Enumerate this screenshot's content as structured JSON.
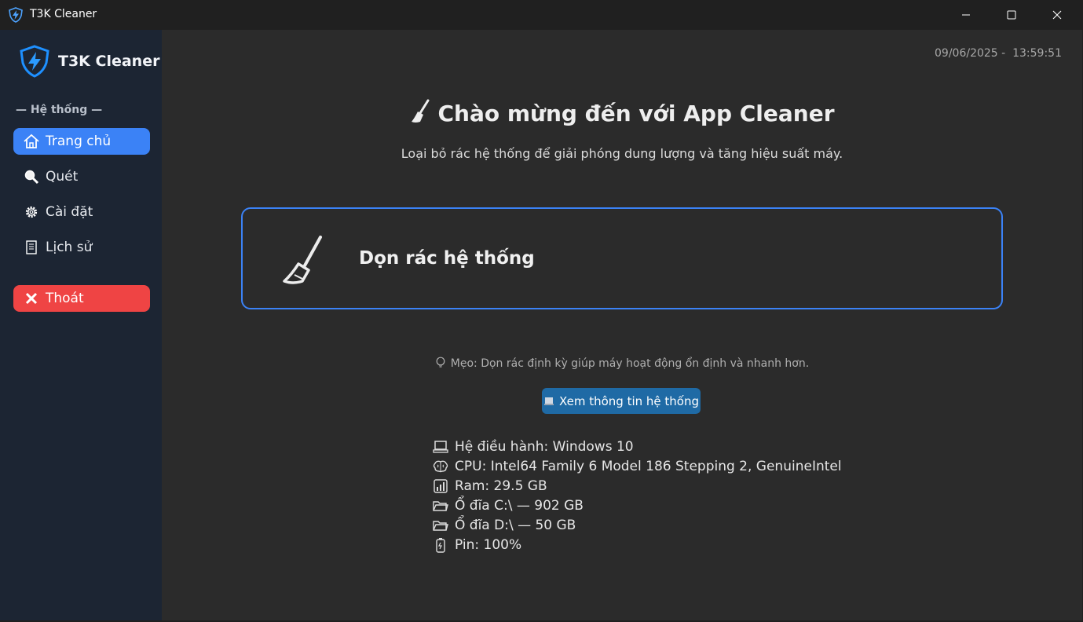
{
  "window": {
    "title": "T3K Cleaner",
    "controls": [
      "minimize-icon",
      "maximize-icon",
      "close-icon"
    ]
  },
  "sidebar": {
    "brand": "T3K Cleaner",
    "section_label": "— Hệ thống —",
    "items": [
      {
        "label": "Trang chủ",
        "icon": "home-icon",
        "active": true
      },
      {
        "label": "Quét",
        "icon": "magnifier-icon",
        "active": false
      },
      {
        "label": "Cài đặt",
        "icon": "gear-icon",
        "active": false
      },
      {
        "label": "Lịch sử",
        "icon": "scroll-icon",
        "active": false
      }
    ],
    "exit_label": "Thoát"
  },
  "main": {
    "date": "09/06/2025",
    "time": "13:59:51",
    "datetime_text": "09/06/2025 -  13:59:51",
    "welcome": "Chào mừng đến với App Cleaner",
    "subtitle": "Loại bỏ rác hệ thống để giải phóng dung lượng và tăng hiệu suất máy.",
    "clean_card_label": "Dọn rác hệ thống",
    "tip": "Mẹo: Dọn rác định kỳ giúp máy hoạt động ổn định và nhanh hơn.",
    "info_button": "Xem thông tin hệ thống",
    "system_info": [
      {
        "icon": "laptop-icon",
        "text": "Hệ điều hành: Windows 10"
      },
      {
        "icon": "brain-icon",
        "text": "CPU: Intel64 Family 6 Model 186 Stepping 2, GenuineIntel"
      },
      {
        "icon": "bar-chart-icon",
        "text": "Ram: 29.5 GB"
      },
      {
        "icon": "folder-icon",
        "text": "Ổ đĩa C:\\ — 902 GB"
      },
      {
        "icon": "folder-icon",
        "text": "Ổ đĩa D:\\ — 50 GB"
      },
      {
        "icon": "battery-icon",
        "text": "Pin: 100%"
      }
    ]
  },
  "colors": {
    "accent": "#3b82f6",
    "danger": "#ef4444",
    "button": "#1f6aa5",
    "sidebar_bg": "#1c2533",
    "main_bg": "#2b2b2b"
  }
}
